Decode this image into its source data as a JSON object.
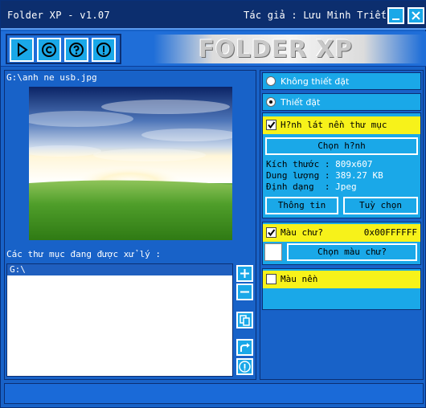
{
  "window": {
    "title": "Folder XP - v1.07",
    "author": "Tác giả : Lưu Minh Triết"
  },
  "toolbar": {
    "buttons": [
      "play-icon",
      "copyright-icon",
      "help-icon",
      "info-icon"
    ],
    "logo": "FOLDER XP"
  },
  "left": {
    "image_path": "G:\\anh ne usb.jpg",
    "folders_label": "Các thư mục đang được xử lý :",
    "folders": [
      "G:\\"
    ]
  },
  "right": {
    "radio_none": "Không thiết đặt",
    "radio_set": "Thiết đặt",
    "bg_image": {
      "label": "H?nh lát nền thư mục",
      "choose_button": "Chọn h?nh",
      "size_line": "Kích thước : ",
      "size_value": "809x607",
      "capacity_line": "Dung lượng : ",
      "capacity_value": "389.27 KB",
      "format_line": "Định dạng  : ",
      "format_value": "Jpeg",
      "info_button": "Thông tin",
      "options_button": "Tuỳ chọn"
    },
    "text_color": {
      "label": "Màu chư?",
      "value": "0x00FFFFFF",
      "choose_button": "Chọn màu chư?"
    },
    "bg_color": {
      "label": "Màu nền"
    }
  },
  "colors": {
    "titlebar": "#0c2e6e",
    "panel": "#1862c8",
    "accent_cyan": "#1aa8e8",
    "yellow": "#f7f21a"
  }
}
